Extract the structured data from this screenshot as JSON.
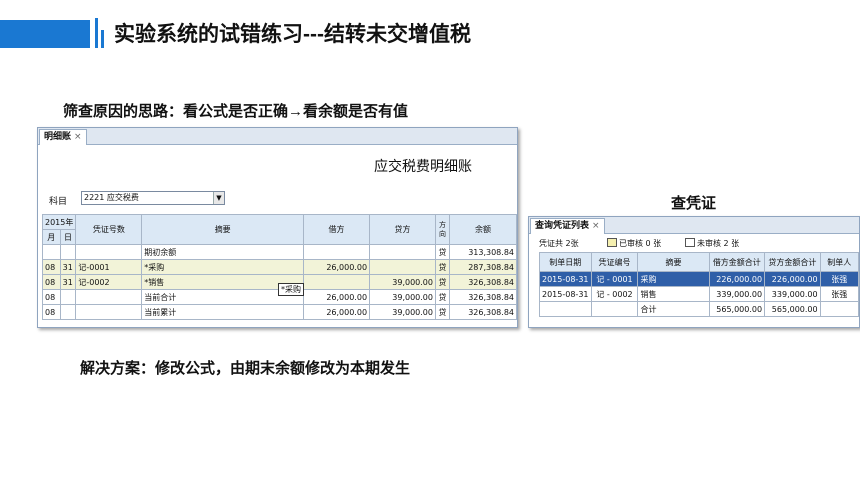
{
  "slide": {
    "title": "实验系统的试错练习---结转未交增值税",
    "note_check": "筛查原因的思路：看公式是否正确→看余额是否有值",
    "note_solution": "解决方案：修改公式，由期末余额修改为本期发生",
    "note_voucher": "查凭证",
    "accent": "#1a78d2"
  },
  "ledger": {
    "tab_label": "明细账",
    "tab_close": "×",
    "title": "应交税费明细账",
    "subject_label": "科目",
    "subject_value": "2221 应交税费",
    "subject_arrow": "▼",
    "headers": {
      "year": "2015年",
      "month": "月",
      "day": "日",
      "voucher_no": "凭证号数",
      "summary": "摘要",
      "debit": "借方",
      "credit": "贷方",
      "direction": "方向",
      "balance": "余额"
    },
    "rows": [
      {
        "month": "",
        "day": "",
        "voucher": "",
        "summary": "期初余额",
        "debit": "",
        "credit": "",
        "dir": "贷",
        "balance": "313,308.84"
      },
      {
        "month": "08",
        "day": "31",
        "voucher": "记-0001",
        "summary": "*采购",
        "debit": "26,000.00",
        "credit": "",
        "dir": "贷",
        "balance": "287,308.84"
      },
      {
        "month": "08",
        "day": "31",
        "voucher": "记-0002",
        "summary": "*销售",
        "debit": "",
        "credit": "39,000.00",
        "dir": "贷",
        "balance": "326,308.84"
      },
      {
        "month": "08",
        "day": "",
        "voucher": "",
        "summary": "当前合计",
        "debit": "26,000.00",
        "credit": "39,000.00",
        "dir": "贷",
        "balance": "326,308.84"
      },
      {
        "month": "08",
        "day": "",
        "voucher": "",
        "summary": "当前累计",
        "debit": "26,000.00",
        "credit": "39,000.00",
        "dir": "贷",
        "balance": "326,308.84"
      }
    ],
    "tooltip": "*采购"
  },
  "voucher_list": {
    "tab_label": "查询凭证列表",
    "tab_close": "×",
    "summary_total": "凭证共 2张",
    "summary_audited": "已审核 0 张",
    "summary_unaudited": "未审核 2 张",
    "headers": [
      "制单日期",
      "凭证编号",
      "摘要",
      "借方金额合计",
      "贷方金额合计",
      "制单人"
    ],
    "rows": [
      [
        "2015-08-31",
        "记 - 0001",
        "采购",
        "226,000.00",
        "226,000.00",
        "张强"
      ],
      [
        "2015-08-31",
        "记 - 0002",
        "销售",
        "339,000.00",
        "339,000.00",
        "张强"
      ],
      [
        "",
        "",
        "合计",
        "565,000.00",
        "565,000.00",
        ""
      ]
    ]
  }
}
